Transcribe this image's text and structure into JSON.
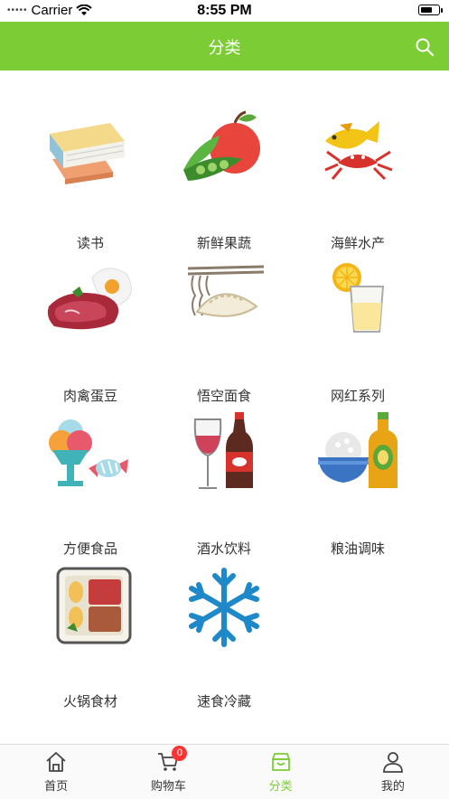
{
  "status_bar": {
    "carrier": "Carrier",
    "time": "8:55 PM"
  },
  "nav": {
    "title": "分类"
  },
  "categories": [
    {
      "label": "读书",
      "icon": "books-icon"
    },
    {
      "label": "新鲜果蔬",
      "icon": "fruit-vegetable-icon"
    },
    {
      "label": "海鲜水产",
      "icon": "seafood-icon"
    },
    {
      "label": "肉禽蛋豆",
      "icon": "meat-egg-icon"
    },
    {
      "label": "悟空面食",
      "icon": "noodles-dumpling-icon"
    },
    {
      "label": "网红系列",
      "icon": "lemon-drink-icon"
    },
    {
      "label": "方便食品",
      "icon": "icecream-candy-icon"
    },
    {
      "label": "酒水饮料",
      "icon": "wine-cola-icon"
    },
    {
      "label": "粮油调味",
      "icon": "rice-oil-icon"
    },
    {
      "label": "火锅食材",
      "icon": "hotpot-icon"
    },
    {
      "label": "速食冷藏",
      "icon": "snowflake-icon"
    }
  ],
  "tabbar": {
    "items": [
      {
        "label": "首页",
        "icon": "home-icon"
      },
      {
        "label": "购物车",
        "icon": "cart-icon",
        "badge": "0"
      },
      {
        "label": "分类",
        "icon": "category-icon",
        "active": true
      },
      {
        "label": "我的",
        "icon": "profile-icon"
      }
    ]
  },
  "colors": {
    "accent": "#7ccd35",
    "badge": "#ff3333"
  }
}
